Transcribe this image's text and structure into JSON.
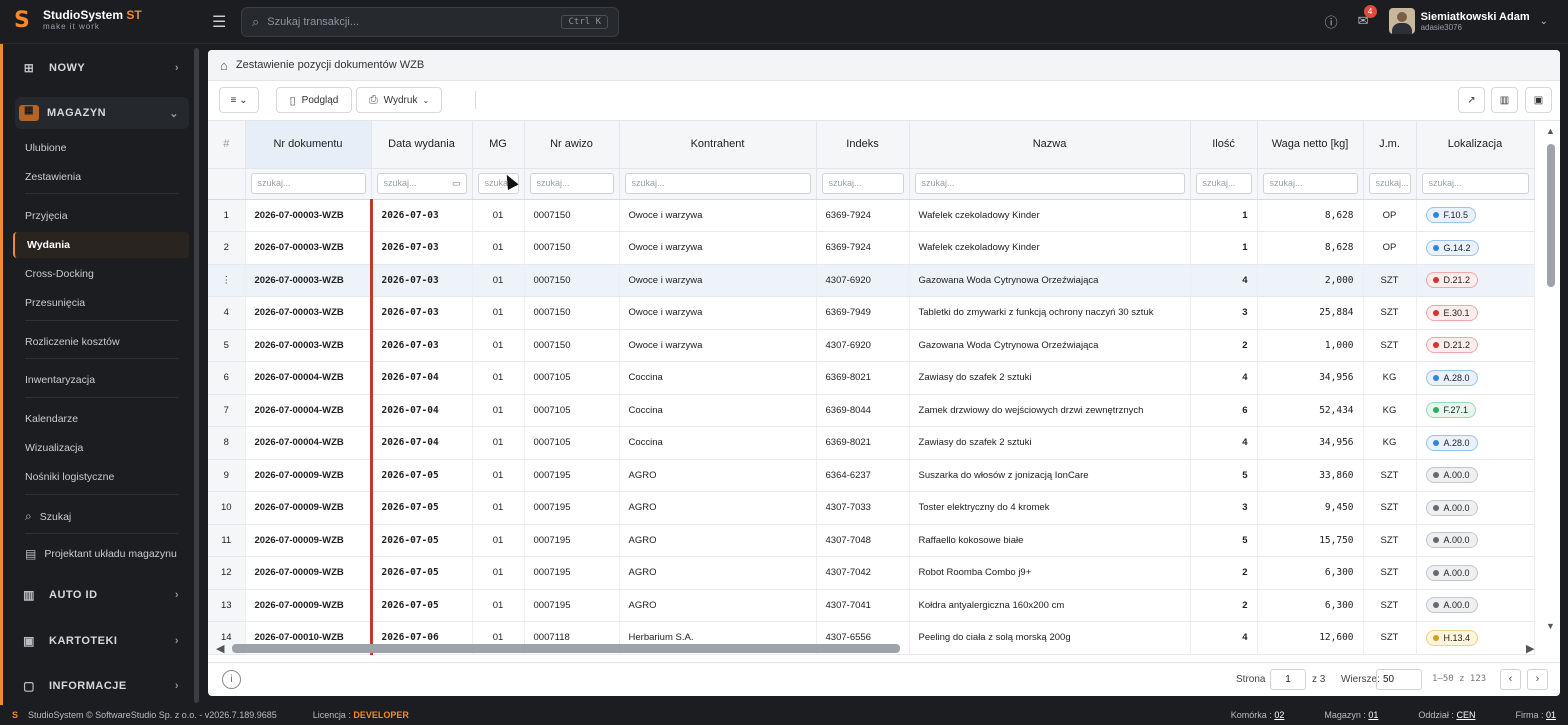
{
  "app": {
    "name": "StudioSystem",
    "name_accent": "ST",
    "tagline": "make it work",
    "search_placeholder": "Szukaj transakcji...",
    "search_shortcut": "Ctrl K",
    "mail_count": "4",
    "user_name": "Siemiatkowski Adam",
    "user_login": "adasie3076",
    "accent": "#f08a2c"
  },
  "sidebar": {
    "groups": {
      "nowy": "NOWY",
      "magazyn": "MAGAZYN",
      "auto_id": "AUTO ID",
      "kartoteki": "KARTOTEKI",
      "informacje": "INFORMACJE"
    },
    "items": {
      "ulubione": "Ulubione",
      "zestawienia": "Zestawienia",
      "przyjecia": "Przyjęcia",
      "wydania": "Wydania",
      "cross_docking": "Cross-Docking",
      "przesuniecia": "Przesunięcia",
      "rozliczenie": "Rozliczenie kosztów",
      "inwentaryzacja": "Inwentaryzacja",
      "kalendarze": "Kalendarze",
      "wizualizacja": "Wizualizacja",
      "nosniki": "Nośniki logistyczne",
      "szukaj": "Szukaj",
      "projektant": "Projektant układu magazynu"
    }
  },
  "page": {
    "title": "Zestawienie pozycji dokumentów WZB",
    "toolbar": {
      "preview": "Podgląd",
      "print": "Wydruk"
    }
  },
  "table": {
    "rownum_header": "#",
    "columns": [
      "Nr dokumentu",
      "Data wydania",
      "MG",
      "Nr awizo",
      "Kontrahent",
      "Indeks",
      "Nazwa",
      "Ilość",
      "Waga netto [kg]",
      "J.m.",
      "Lokalizacja"
    ],
    "filter_placeholder": "szukaj...",
    "rows": [
      {
        "n": "1",
        "doc": "2026-07-00003-WZB",
        "date": "2026-07-03",
        "mg": "01",
        "awizo": "0007150",
        "kontrahent": "Owoce i warzywa",
        "indeks": "6369-7924",
        "nazwa": "Wafelek czekoladowy Kinder",
        "ilosc": "1",
        "waga": "8,628",
        "jm": "OP",
        "lok": "F.10.5",
        "lok_color": "blue"
      },
      {
        "n": "2",
        "doc": "2026-07-00003-WZB",
        "date": "2026-07-03",
        "mg": "01",
        "awizo": "0007150",
        "kontrahent": "Owoce i warzywa",
        "indeks": "6369-7924",
        "nazwa": "Wafelek czekoladowy Kinder",
        "ilosc": "1",
        "waga": "8,628",
        "jm": "OP",
        "lok": "G.14.2",
        "lok_color": "blue"
      },
      {
        "n": "⋮",
        "doc": "2026-07-00003-WZB",
        "date": "2026-07-03",
        "mg": "01",
        "awizo": "0007150",
        "kontrahent": "Owoce i warzywa",
        "indeks": "4307-6920",
        "nazwa": "Gazowana Woda Cytrynowa Orzeźwiająca",
        "ilosc": "4",
        "waga": "2,000",
        "jm": "SZT",
        "lok": "D.21.2",
        "lok_color": "red"
      },
      {
        "n": "4",
        "doc": "2026-07-00003-WZB",
        "date": "2026-07-03",
        "mg": "01",
        "awizo": "0007150",
        "kontrahent": "Owoce i warzywa",
        "indeks": "6369-7949",
        "nazwa": "Tabletki do zmywarki z funkcją ochrony naczyń 30 sztuk",
        "ilosc": "3",
        "waga": "25,884",
        "jm": "SZT",
        "lok": "E.30.1",
        "lok_color": "red"
      },
      {
        "n": "5",
        "doc": "2026-07-00003-WZB",
        "date": "2026-07-03",
        "mg": "01",
        "awizo": "0007150",
        "kontrahent": "Owoce i warzywa",
        "indeks": "4307-6920",
        "nazwa": "Gazowana Woda Cytrynowa Orzeźwiająca",
        "ilosc": "2",
        "waga": "1,000",
        "jm": "SZT",
        "lok": "D.21.2",
        "lok_color": "red"
      },
      {
        "n": "6",
        "doc": "2026-07-00004-WZB",
        "date": "2026-07-04",
        "mg": "01",
        "awizo": "0007105",
        "kontrahent": "Coccina",
        "indeks": "6369-8021",
        "nazwa": "Zawiasy do szafek 2 sztuki",
        "ilosc": "4",
        "waga": "34,956",
        "jm": "KG",
        "lok": "A.28.0",
        "lok_color": "blue"
      },
      {
        "n": "7",
        "doc": "2026-07-00004-WZB",
        "date": "2026-07-04",
        "mg": "01",
        "awizo": "0007105",
        "kontrahent": "Coccina",
        "indeks": "6369-8044",
        "nazwa": "Zamek drzwiowy do wejściowych drzwi zewnętrznych",
        "ilosc": "6",
        "waga": "52,434",
        "jm": "KG",
        "lok": "F.27.1",
        "lok_color": "green"
      },
      {
        "n": "8",
        "doc": "2026-07-00004-WZB",
        "date": "2026-07-04",
        "mg": "01",
        "awizo": "0007105",
        "kontrahent": "Coccina",
        "indeks": "6369-8021",
        "nazwa": "Zawiasy do szafek 2 sztuki",
        "ilosc": "4",
        "waga": "34,956",
        "jm": "KG",
        "lok": "A.28.0",
        "lok_color": "blue"
      },
      {
        "n": "9",
        "doc": "2026-07-00009-WZB",
        "date": "2026-07-05",
        "mg": "01",
        "awizo": "0007195",
        "kontrahent": "AGRO",
        "indeks": "6364-6237",
        "nazwa": "Suszarka do włosów z jonizacją IonCare",
        "ilosc": "5",
        "waga": "33,860",
        "jm": "SZT",
        "lok": "A.00.0",
        "lok_color": "gray"
      },
      {
        "n": "10",
        "doc": "2026-07-00009-WZB",
        "date": "2026-07-05",
        "mg": "01",
        "awizo": "0007195",
        "kontrahent": "AGRO",
        "indeks": "4307-7033",
        "nazwa": "Toster elektryczny do 4 kromek",
        "ilosc": "3",
        "waga": "9,450",
        "jm": "SZT",
        "lok": "A.00.0",
        "lok_color": "gray"
      },
      {
        "n": "11",
        "doc": "2026-07-00009-WZB",
        "date": "2026-07-05",
        "mg": "01",
        "awizo": "0007195",
        "kontrahent": "AGRO",
        "indeks": "4307-7048",
        "nazwa": "Raffaello kokosowe białe",
        "ilosc": "5",
        "waga": "15,750",
        "jm": "SZT",
        "lok": "A.00.0",
        "lok_color": "gray"
      },
      {
        "n": "12",
        "doc": "2026-07-00009-WZB",
        "date": "2026-07-05",
        "mg": "01",
        "awizo": "0007195",
        "kontrahent": "AGRO",
        "indeks": "4307-7042",
        "nazwa": "Robot Roomba Combo j9+",
        "ilosc": "2",
        "waga": "6,300",
        "jm": "SZT",
        "lok": "A.00.0",
        "lok_color": "gray"
      },
      {
        "n": "13",
        "doc": "2026-07-00009-WZB",
        "date": "2026-07-05",
        "mg": "01",
        "awizo": "0007195",
        "kontrahent": "AGRO",
        "indeks": "4307-7041",
        "nazwa": "Kołdra antyalergiczna 160x200 cm",
        "ilosc": "2",
        "waga": "6,300",
        "jm": "SZT",
        "lok": "A.00.0",
        "lok_color": "gray"
      },
      {
        "n": "14",
        "doc": "2026-07-00010-WZB",
        "date": "2026-07-06",
        "mg": "01",
        "awizo": "0007118",
        "kontrahent": "Herbarium S.A.",
        "indeks": "4307-6556",
        "nazwa": "Peeling do ciała z solą morską 200g",
        "ilosc": "4",
        "waga": "12,600",
        "jm": "SZT",
        "lok": "H.13.4",
        "lok_color": "yellow"
      }
    ]
  },
  "pager": {
    "page_label": "Strona",
    "page": "1",
    "of": "z 3",
    "rows_label": "Wiersze:",
    "rows": "50",
    "range": "1–50 z 123"
  },
  "footer": {
    "copyright": "StudioSystem © SoftwareStudio Sp. z o.o. - v2026.7.189.9685",
    "license_label": "Licencja :",
    "license": "DEVELOPER",
    "cell_label": "Komórka :",
    "cell": "02",
    "warehouse_label": "Magazyn :",
    "warehouse": "01",
    "branch_label": "Oddział :",
    "branch": "CEN",
    "company_label": "Firma :",
    "company": "01"
  }
}
